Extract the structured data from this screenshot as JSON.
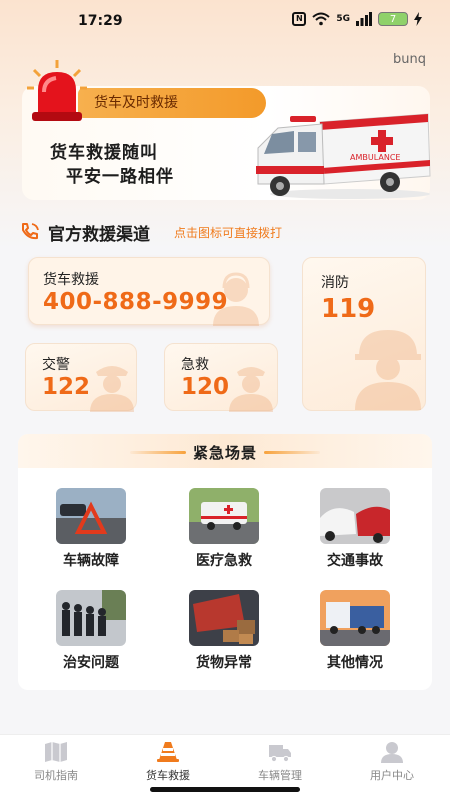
{
  "status_bar": {
    "time": "17:29",
    "network": "5G",
    "battery": "7"
  },
  "brand": "bunq",
  "banner": {
    "badge": "货车及时救援",
    "slogan_line1": "货车救援随叫",
    "slogan_line2": "平安一路相伴",
    "ambulance_text": "AMBULANCE"
  },
  "hotlines_section": {
    "title": "官方救援渠道",
    "hint": "点击图标可直接拨打",
    "cards": [
      {
        "label": "货车救援",
        "number": "400-888-9999"
      },
      {
        "label": "消防",
        "number": "119"
      },
      {
        "label": "交警",
        "number": "122"
      },
      {
        "label": "急救",
        "number": "120"
      }
    ]
  },
  "emergency": {
    "title": "紧急场景",
    "scenes": [
      {
        "label": "车辆故障"
      },
      {
        "label": "医疗急救"
      },
      {
        "label": "交通事故"
      },
      {
        "label": "治安问题"
      },
      {
        "label": "货物异常"
      },
      {
        "label": "其他情况"
      }
    ]
  },
  "tabbar": {
    "tabs": [
      {
        "label": "司机指南",
        "icon": "book-map-icon",
        "active": false
      },
      {
        "label": "货车救援",
        "icon": "traffic-cone-icon",
        "active": true
      },
      {
        "label": "车辆管理",
        "icon": "truck-icon",
        "active": false
      },
      {
        "label": "用户中心",
        "icon": "user-icon",
        "active": false
      }
    ]
  },
  "colors": {
    "accent": "#ef6a18",
    "badge": "#f39a2a",
    "card_bg": "#fdebd9"
  }
}
